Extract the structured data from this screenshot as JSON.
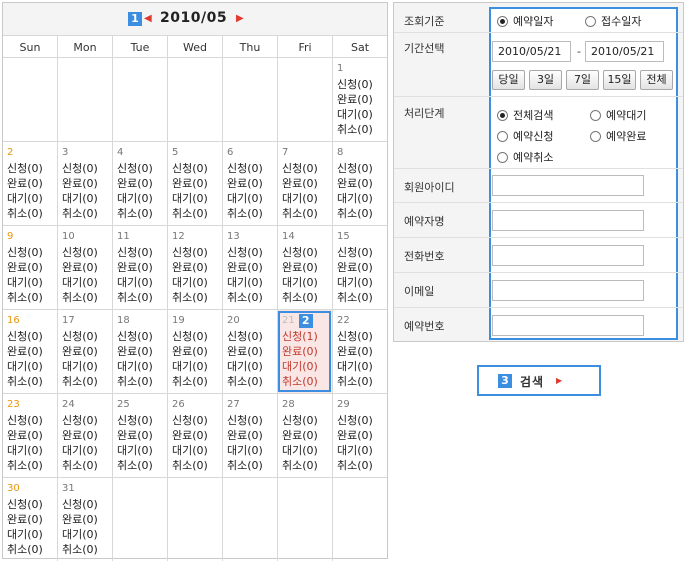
{
  "calendar": {
    "badge": "1",
    "prev_icon": "◀",
    "next_icon": "▶",
    "title": "2010/05",
    "weekdays": [
      "Sun",
      "Mon",
      "Tue",
      "Wed",
      "Thu",
      "Fri",
      "Sat"
    ],
    "selected_badge": "2",
    "count_labels": [
      "신청(0)",
      "완료(0)",
      "대기(0)",
      "취소(0)"
    ],
    "selected_counts": [
      "신청(1)",
      "완료(0)",
      "대기(0)",
      "취소(0)"
    ],
    "weeks": [
      [
        "",
        "",
        "",
        "",
        "",
        "",
        "1"
      ],
      [
        "2",
        "3",
        "4",
        "5",
        "6",
        "7",
        "8"
      ],
      [
        "9",
        "10",
        "11",
        "12",
        "13",
        "14",
        "15"
      ],
      [
        "16",
        "17",
        "18",
        "19",
        "20",
        "21",
        "22"
      ],
      [
        "23",
        "24",
        "25",
        "26",
        "27",
        "28",
        "29"
      ],
      [
        "30",
        "31",
        "",
        "",
        "",
        "",
        ""
      ]
    ],
    "selected_day": "21",
    "colors": {
      "sunday": "#e8960c",
      "accent": "#3b8ee0",
      "selected_bg": "#fbe6e6",
      "selected_text": "#c0392b"
    }
  },
  "form": {
    "criteria": {
      "label": "조회기준",
      "options": [
        {
          "label": "예약일자",
          "checked": true
        },
        {
          "label": "접수일자",
          "checked": false
        }
      ]
    },
    "period": {
      "label": "기간선택",
      "from": "2010/05/21",
      "separator": "-",
      "to": "2010/05/21",
      "quick_buttons": [
        "당일",
        "3일",
        "7일",
        "15일",
        "전체"
      ]
    },
    "status": {
      "label": "처리단계",
      "options": [
        {
          "label": "전체검색",
          "checked": true
        },
        {
          "label": "예약대기",
          "checked": false
        },
        {
          "label": "예약신청",
          "checked": false
        },
        {
          "label": "예약완료",
          "checked": false
        },
        {
          "label": "예약취소",
          "checked": false
        }
      ]
    },
    "member_id": {
      "label": "회원아이디",
      "value": ""
    },
    "reserver_name": {
      "label": "예약자명",
      "value": ""
    },
    "phone": {
      "label": "전화번호",
      "value": ""
    },
    "email": {
      "label": "이메일",
      "value": ""
    },
    "reservation_no": {
      "label": "예약번호",
      "value": ""
    }
  },
  "search": {
    "badge": "3",
    "label": "검색",
    "arrow_icon": "▶"
  }
}
